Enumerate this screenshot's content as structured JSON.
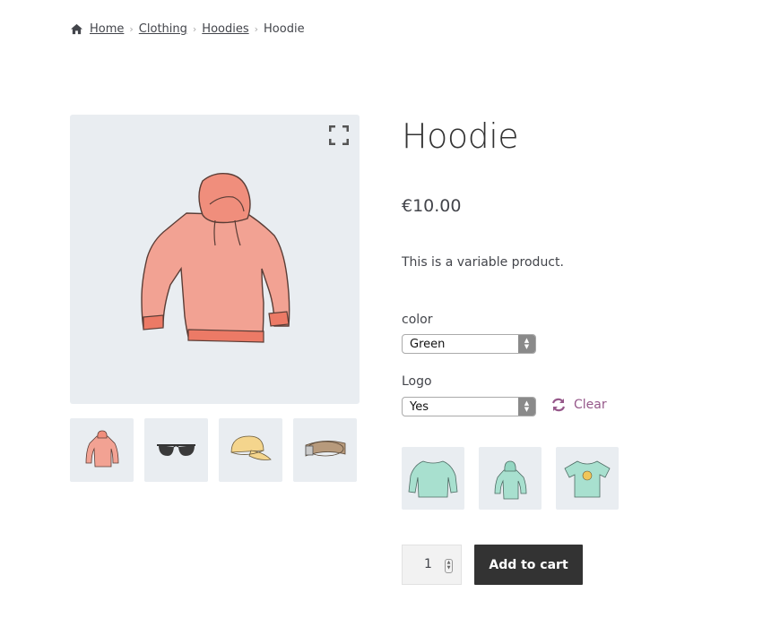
{
  "breadcrumb": {
    "home": "Home",
    "category": "Clothing",
    "subcategory": "Hoodies",
    "current": "Hoodie",
    "separator": "›"
  },
  "product": {
    "title": "Hoodie",
    "price": "€10.00",
    "description": "This is a variable product."
  },
  "variations": {
    "color_label": "color",
    "color_value": "Green",
    "logo_label": "Logo",
    "logo_value": "Yes",
    "clear_label": "Clear"
  },
  "cart": {
    "quantity": "1",
    "add_label": "Add to cart"
  },
  "colors": {
    "accent": "#96588a",
    "button": "#333333",
    "image_bg": "#e9edf1",
    "hoodie": "#f2a293",
    "green_product": "#a8e0cf"
  }
}
